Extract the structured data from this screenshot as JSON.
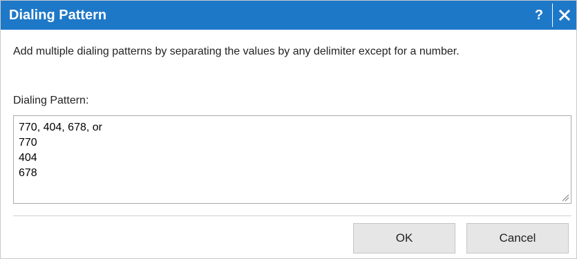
{
  "dialog": {
    "title": "Dialing Pattern",
    "help_label": "?",
    "close_icon": "close-icon",
    "description": "Add multiple dialing patterns by separating the values by any delimiter except for a number.",
    "field_label": "Dialing Pattern:",
    "field_value": "770, 404, 678, or\n770\n404\n678",
    "ok_label": "OK",
    "cancel_label": "Cancel"
  },
  "colors": {
    "titlebar": "#1e78c8",
    "title_text": "#ffffff",
    "button_bg": "#e6e6e6"
  }
}
